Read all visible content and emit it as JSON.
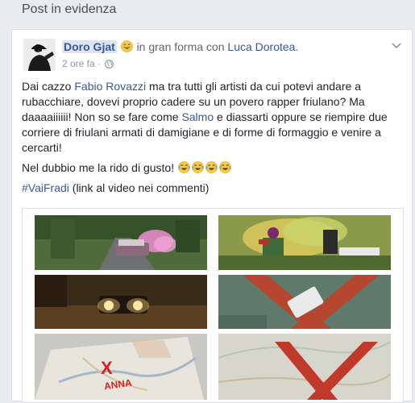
{
  "section": {
    "title": "Post in evidenza"
  },
  "post": {
    "author": "Doro Gjat",
    "status_text": "in gran forma con",
    "tagged": "Luca Dorotea",
    "period": ".",
    "time": "2 ore fa",
    "separator": "·",
    "icons": {
      "avatar": "profile-photo",
      "feeling": "grinning-face-icon",
      "privacy": "globe-icon",
      "menu": "chevron-down-icon",
      "laugh": "tears-of-joy-icon"
    },
    "paragraph1": {
      "t1": "Dai cazzo ",
      "mention1": "Fabio Rovazzi",
      "t2": " ma tra tutti gli artisti da cui potevi andare a rubacchiare, dovevi proprio cadere su un povero rapper friulano? Ma daaaaiiiiii! Non so se fare come ",
      "mention2": "Salmo",
      "t3": " e diassarti oppure se riempire due corriere di friulani armati di damigiane e di forme di formaggio e venire a cercarti!"
    },
    "paragraph2": {
      "text": "Nel dubbio me la rido di gusto! "
    },
    "paragraph3": {
      "hashtag": "#VaiFradi",
      "text": " (link al video nei commenti)"
    },
    "media": {
      "map_labels": [
        "X",
        "ANNA"
      ]
    }
  },
  "colors": {
    "background": "#e9ebee",
    "link": "#365899",
    "meta": "#90949c",
    "text": "#1d2129"
  }
}
